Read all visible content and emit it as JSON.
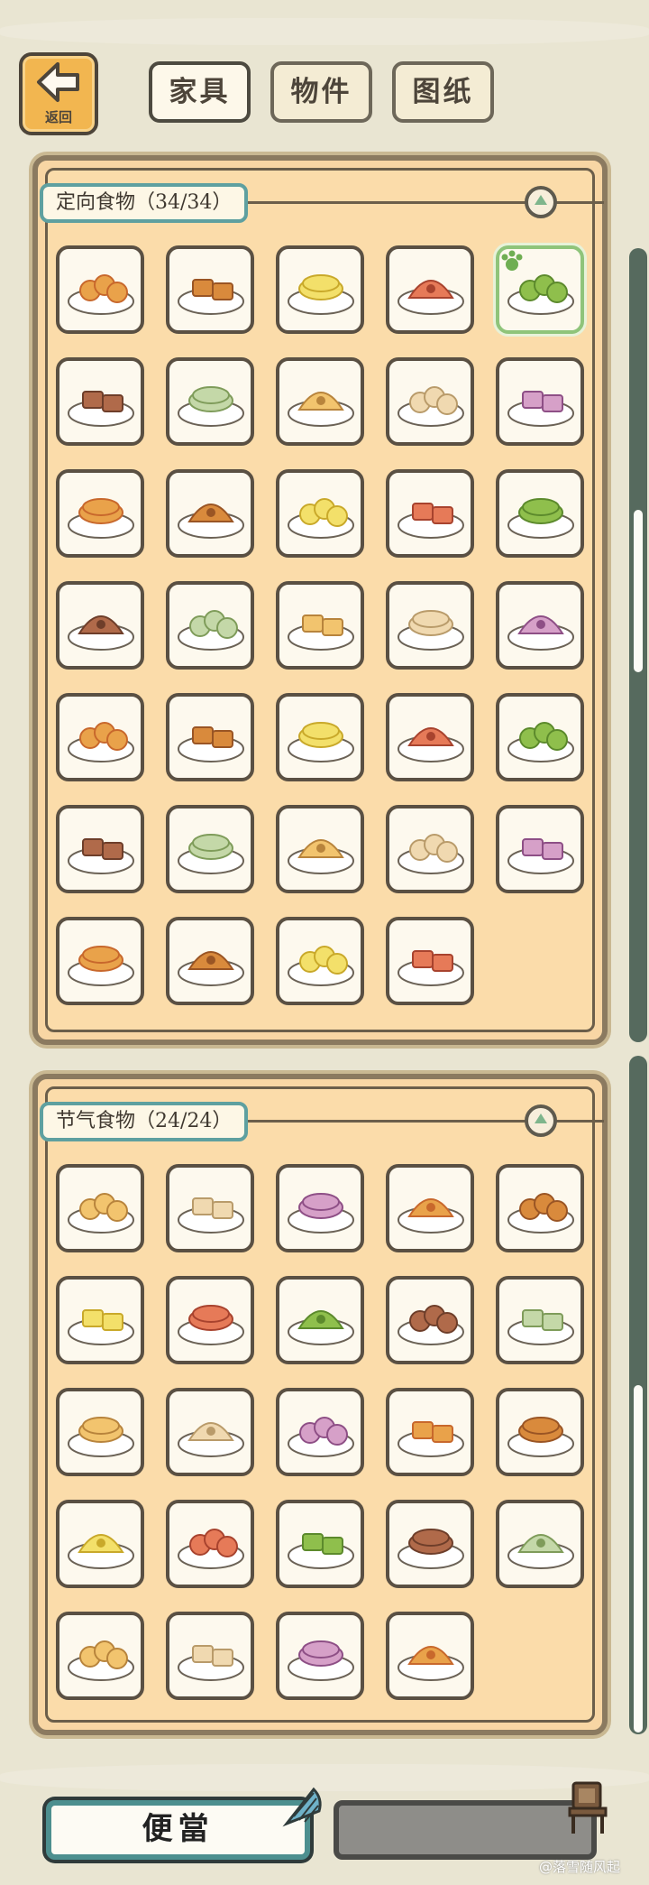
{
  "header": {
    "back_label": "返回",
    "tabs": [
      {
        "label": "家具"
      },
      {
        "label": "物件"
      },
      {
        "label": "图纸"
      }
    ]
  },
  "sections": [
    {
      "title": "定向食物（34/34）",
      "count": 34,
      "selected_index": 4,
      "items": [
        "dumpling-plate",
        "round-pancakes",
        "sesame-cakes",
        "mooncake-stamp",
        "flower-cookies",
        "green-cakes",
        "orange-buns",
        "rolls-tray",
        "yellow-cake-slices",
        "pumpkin-cakes",
        "spring-rolls",
        "tofu-blocks",
        "cookie-stack",
        "noodles-pile",
        "layer-cake",
        "orange-buns-2",
        "bagel-rings",
        "grey-dumplings",
        "mochi-cups",
        "omelette",
        "white-buns",
        "steamed-buns",
        "sandwich-cakes",
        "brown-cakes",
        "golden-rolls",
        "donuts",
        "flatbread-stack",
        "crispy-pancakes",
        "yellow-balls",
        "fried-rolls",
        "orange-pancake",
        "tofu-cubes",
        "fried-pastry",
        "pie-slices"
      ]
    },
    {
      "title": "节气食物（24/24）",
      "count": 24,
      "items": [
        "sliced-meat",
        "soup-bowl",
        "skewers",
        "purple-buns",
        "stew-bowl",
        "roast-plate",
        "egg-custard",
        "fish-balls",
        "brown-squares",
        "bean-soup",
        "spring-roll-plate",
        "pickle-jar",
        "noodle-soup",
        "flower-cake",
        "green-rice-balls",
        "veggie-plate",
        "porridge",
        "peach-jar",
        "green-jar",
        "shumai",
        "jelly-bowl",
        "shaved-ice",
        "fruit-bowl",
        "rice-cakes"
      ]
    }
  ],
  "bottom": {
    "bento_label": "便當"
  },
  "watermark": "@落雪随风起",
  "colors": {
    "panel": "#f8d6a4",
    "frame": "#8b7a60",
    "accent": "#5ea0a0",
    "background": "#e9e5d2"
  }
}
